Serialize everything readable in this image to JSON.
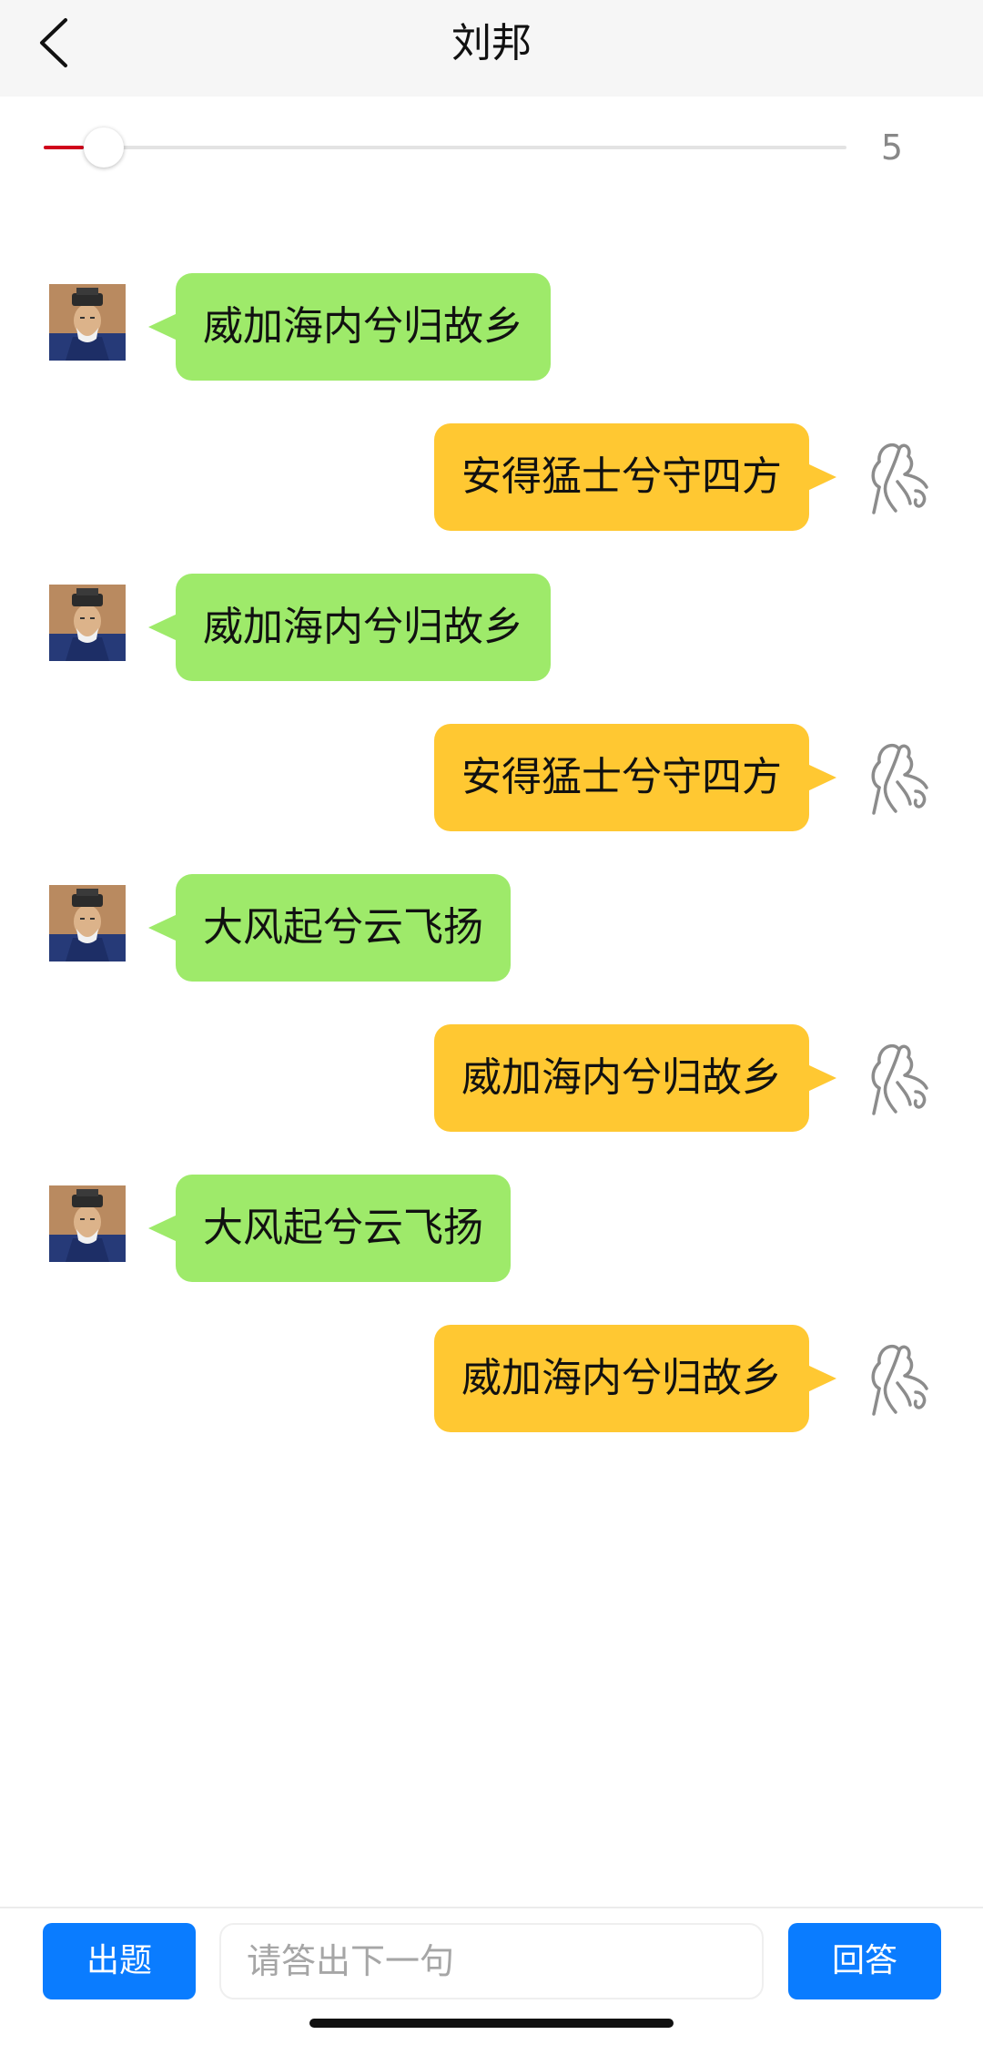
{
  "header": {
    "title": "刘邦",
    "back_icon": "chevron-left-icon"
  },
  "slider": {
    "value": 5,
    "value_label": "5",
    "min": 0,
    "max": 100,
    "fill_color": "#d0021b"
  },
  "colors": {
    "poet_bubble": "#9eea6a",
    "user_bubble": "#ffc832",
    "button_blue": "#0a7cff"
  },
  "messages": [
    {
      "side": "left",
      "speaker": "poet",
      "text": "威加海内兮归故乡"
    },
    {
      "side": "right",
      "speaker": "user",
      "text": "安得猛士兮守四方"
    },
    {
      "side": "left",
      "speaker": "poet",
      "text": "威加海内兮归故乡"
    },
    {
      "side": "right",
      "speaker": "user",
      "text": "安得猛士兮守四方"
    },
    {
      "side": "left",
      "speaker": "poet",
      "text": "大风起兮云飞扬"
    },
    {
      "side": "right",
      "speaker": "user",
      "text": "威加海内兮归故乡"
    },
    {
      "side": "left",
      "speaker": "poet",
      "text": "大风起兮云飞扬"
    },
    {
      "side": "right",
      "speaker": "user",
      "text": "威加海内兮归故乡"
    }
  ],
  "input_bar": {
    "question_button": "出题",
    "answer_placeholder": "请答出下一句",
    "answer_value": "",
    "answer_button": "回答"
  }
}
